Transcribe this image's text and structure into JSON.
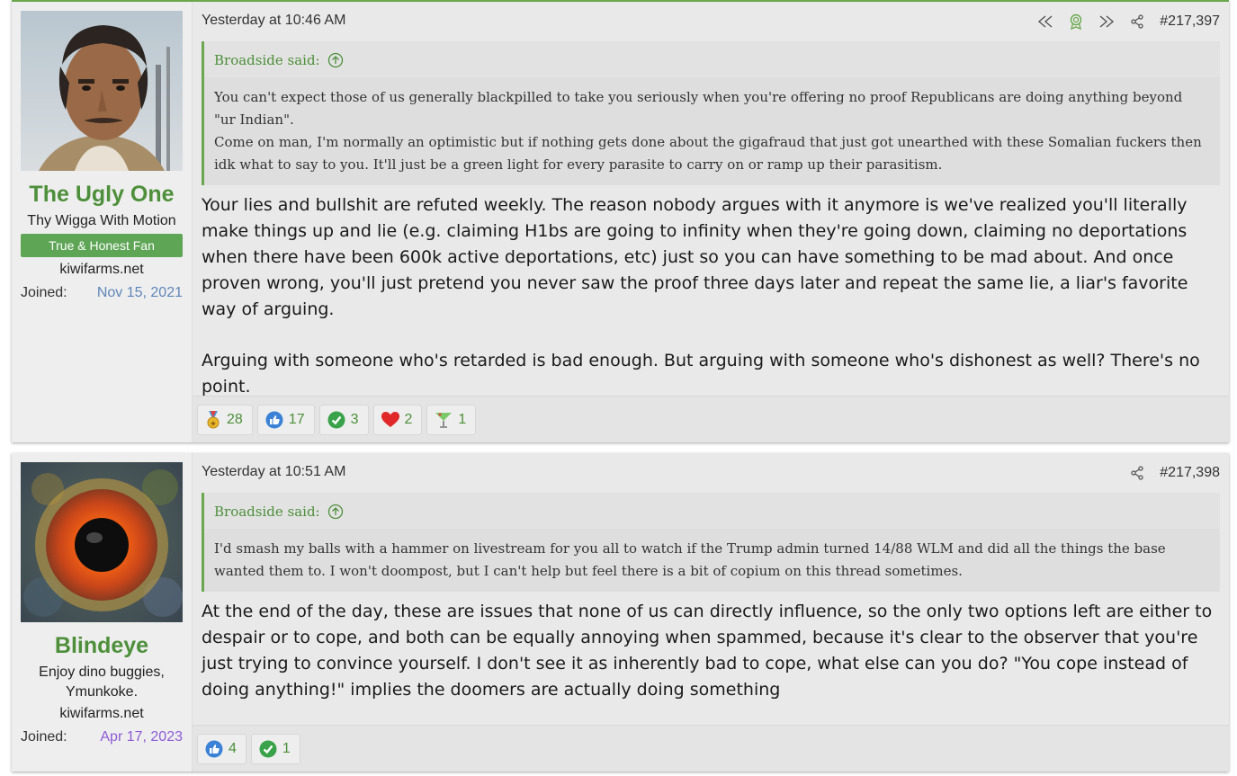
{
  "posts": [
    {
      "user": {
        "name": "The Ugly One",
        "title": "Thy Wigga With Motion",
        "banner": "True & Honest Fan",
        "site": "kiwifarms.net",
        "joined_label": "Joined:",
        "joined_date": "Nov 15, 2021"
      },
      "timestamp": "Yesterday at 10:46 AM",
      "post_number": "#217,397",
      "quote": {
        "author": "Broadside said:",
        "lines": [
          "You can't expect those of us generally blackpilled to take you seriously when you're offering no proof Republicans are doing anything beyond \"ur Indian\".",
          "Come on man, I'm normally an optimistic but if nothing gets done about the gigafraud that just got unearthed with these Somalian fuckers then idk what to say to you. It'll just be a green light for every parasite to carry on or ramp up their parasitism."
        ]
      },
      "message": [
        "Your lies and bullshit are refuted weekly. The reason nobody argues with it anymore is we've realized you'll literally make things up and lie (e.g. claiming H1bs are going to infinity when they're going down, claiming no deportations when there have been 600k active deportations, etc) just so you can have something to be mad about. And once proven wrong, you'll just pretend you never saw the proof three days later and repeat the same lie, a liar's favorite way of arguing.",
        "Arguing with someone who's retarded is bad enough. But arguing with someone who's dishonest as well? There's no point."
      ],
      "reactions": [
        {
          "icon": "medal-icon",
          "count": "28"
        },
        {
          "icon": "thumbs-up-icon",
          "count": "17"
        },
        {
          "icon": "check-icon",
          "count": "3"
        },
        {
          "icon": "heart-icon",
          "count": "2"
        },
        {
          "icon": "cocktail-icon",
          "count": "1"
        }
      ]
    },
    {
      "user": {
        "name": "Blindeye",
        "title": "Enjoy dino buggies, Ymunkoke.",
        "site": "kiwifarms.net",
        "joined_label": "Joined:",
        "joined_date": "Apr 17, 2023"
      },
      "timestamp": "Yesterday at 10:51 AM",
      "post_number": "#217,398",
      "quote": {
        "author": "Broadside said:",
        "lines": [
          "I'd smash my balls with a hammer on livestream for you all to watch if the Trump admin turned 14/88 WLM and did all the things the base wanted them to. I won't doompost, but I can't help but feel there is a bit of copium on this thread sometimes."
        ]
      },
      "message": [
        "At the end of the day, these are issues that none of us can directly influence, so the only two options left are either to despair or to cope, and both can be equally annoying when spammed, because it's clear to the observer that you're just trying to convince yourself. I don't see it as inherently bad to cope, what else can you do? \"You cope instead of doing anything!\" implies the doomers are actually doing something"
      ],
      "reactions": [
        {
          "icon": "thumbs-up-icon",
          "count": "4"
        },
        {
          "icon": "check-icon",
          "count": "1"
        }
      ]
    }
  ],
  "colors": {
    "accent_green": "#4d8f3a",
    "banner_green": "#5ea556",
    "joined_blue": "#5f86b8",
    "joined_purple": "#8d5cd6"
  }
}
